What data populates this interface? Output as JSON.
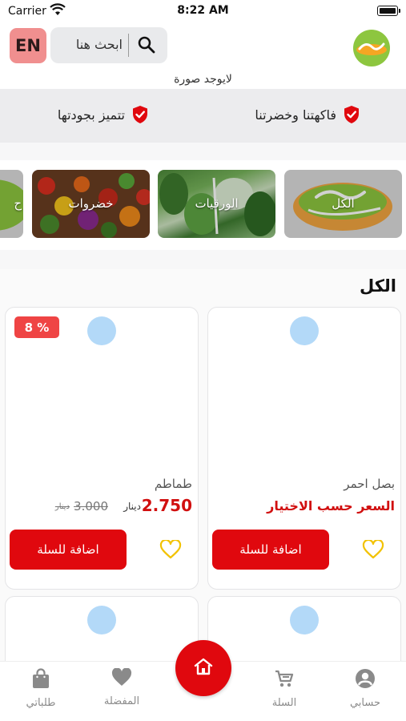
{
  "status_bar": {
    "carrier": "Carrier",
    "time": "8:22 AM"
  },
  "header": {
    "lang_button": "EN",
    "search_placeholder": "ابحث هنا",
    "no_image_text": "لايوجد صورة"
  },
  "features": [
    {
      "label": "فاكهتنا وخضرتنا",
      "icon": "shield-check-icon"
    },
    {
      "label": "تتميز بجودتها",
      "icon": "shield-check-icon"
    }
  ],
  "categories": [
    {
      "label": "الكل"
    },
    {
      "label": "الورقيات"
    },
    {
      "label": "خضروات"
    },
    {
      "label": "ح"
    }
  ],
  "section": {
    "title": "الكل"
  },
  "products": [
    {
      "name": "بصل احمر",
      "price_text": "السعر حسب الاختيار",
      "add_label": "اضافة للسلة"
    },
    {
      "name": "طماطم",
      "price": "2.750",
      "currency": "دينار",
      "old_price": "3.000",
      "old_currency": "دينار",
      "discount": "8 %",
      "add_label": "اضافة للسلة"
    }
  ],
  "bottom_nav": [
    {
      "label": "حسابي",
      "icon": "account-icon"
    },
    {
      "label": "السلة",
      "icon": "cart-icon"
    },
    {
      "label": "الرئيسية",
      "icon": "home-icon"
    },
    {
      "label": "المفضلة",
      "icon": "heart-icon"
    },
    {
      "label": "طلباتي",
      "icon": "shopping-bag-icon"
    }
  ],
  "colors": {
    "accent": "#e0080e",
    "lang_bg": "#f08f8f",
    "placeholder_dot": "#b3d9f8",
    "heart": "#f2c200"
  }
}
